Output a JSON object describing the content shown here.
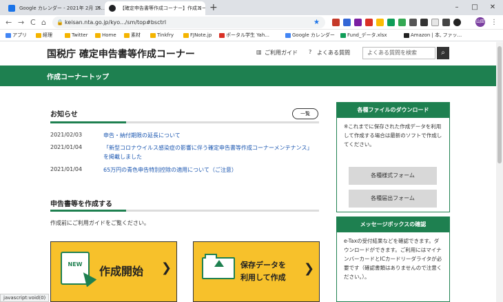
{
  "browser": {
    "tabs": [
      {
        "title": "Google カレンダー - 2021年 2月 15...",
        "favicon_color": "#1a73e8"
      },
      {
        "title": "【確定申告書等作成コーナー】作成コー...",
        "favicon_color": "#202124"
      }
    ],
    "new_tab_label": "+",
    "close_glyph": "×",
    "window_controls": [
      "–",
      "□",
      "✕"
    ],
    "nav": {
      "back": "←",
      "forward": "→",
      "reload": "C",
      "home": "⌂"
    },
    "url": "keisan.nta.go.jp/kyo.../sm/top#bsctrl",
    "star_glyph": "★",
    "avatar_label": "山田",
    "menu_glyph": "⋮",
    "extension_colors": [
      "#c53929",
      "#3367d6",
      "#7b1fa2",
      "#d93025",
      "#fbbc04",
      "#0f9d58",
      "#34a853",
      "#555555",
      "#333333",
      "#e6e6e6",
      "#444444",
      "#222222"
    ],
    "bookmarks": [
      {
        "label": "アプリ",
        "color": "#4285f4"
      },
      {
        "label": "経理",
        "color": "#f4b400"
      },
      {
        "label": "Twitter",
        "color": "#f4b400"
      },
      {
        "label": "Home",
        "color": "#f4b400"
      },
      {
        "label": "素材",
        "color": "#f4b400"
      },
      {
        "label": "Tinkfry",
        "color": "#f4b400"
      },
      {
        "label": "FJNote.jp",
        "color": "#f4b400"
      },
      {
        "label": "ポータル学生 Yah...",
        "color": "#d93025"
      },
      {
        "label": "Google カレンダー",
        "color": "#4285f4"
      },
      {
        "label": "Fund_データ.xlsx",
        "color": "#0f9d58"
      },
      {
        "label": "Amazon | 本, ファッ...",
        "color": "#222222"
      }
    ]
  },
  "site": {
    "title": "国税庁 確定申告書等作成コーナー",
    "guide_link": "ご利用ガイド",
    "faq_link": "よくある質問",
    "search_placeholder": "よくある質問を検索",
    "search_icon": "⌕",
    "page_title": "作成コーナートップ"
  },
  "news": {
    "heading": "お知らせ",
    "list_button": "一覧",
    "items": [
      {
        "date": "2021/02/03",
        "text": "申告・納付期限の延長について"
      },
      {
        "date": "2021/01/04",
        "text": "「新型コロナウイルス感染症の影響に伴う確定申告書等作成コーナーメンテナンス」を掲載しました"
      },
      {
        "date": "2021/01/04",
        "text": "65万円の青色申告特別控除の適用について（ご注意）"
      }
    ]
  },
  "create": {
    "heading": "申告書等を作成する",
    "note": "作成前にご利用ガイドをご覧ください。",
    "start_card": {
      "badge": "NEW",
      "label": "作成開始",
      "arrow": "❯"
    },
    "saved_card": {
      "line1": "保存データを",
      "line2": "利用して作成",
      "arrow": "❯"
    }
  },
  "sidebar": {
    "download_heading": "各種ファイルのダウンロード",
    "download_text": "※これまでに保存された作成データを利用して作成する場合は最新のソフトで作成してください。",
    "form_button_1": "各種様式フォーム",
    "form_button_2": "各種届出フォーム",
    "message_heading": "メッセージボックスの確認",
    "message_text": "e-Taxの受付結果などを確認できます。ダウンロードができます。ご利用にはマイナンバーカードとICカードリーダライタが必要です（確認書類はありませんので注意ください。）。"
  },
  "status_bar": "javascript:void(0)"
}
